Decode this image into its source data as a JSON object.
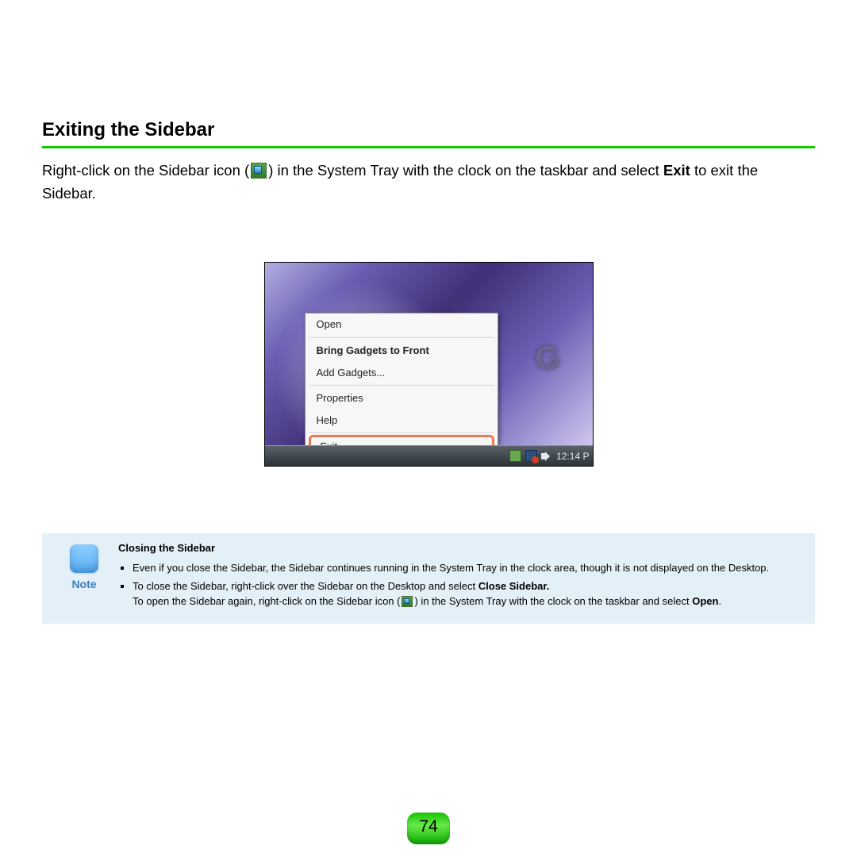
{
  "section": {
    "title": "Exiting the Sidebar",
    "intro_before_icon": "Right-click on the Sidebar icon (",
    "intro_after_icon": ") in the System Tray with the clock on the taskbar and select ",
    "intro_bold": "Exit",
    "intro_tail": " to exit the Sidebar."
  },
  "screenshot": {
    "menu": {
      "open": "Open",
      "bring_front": "Bring Gadgets to Front",
      "add_gadgets": "Add Gadgets...",
      "properties": "Properties",
      "help": "Help",
      "exit": "Exit"
    },
    "taskbar": {
      "clock": "12:14 P"
    }
  },
  "note": {
    "label": "Note",
    "subtitle": "Closing the Sidebar",
    "bullet1": "Even if you close the Sidebar, the Sidebar continues running in the System Tray in the clock area, though it is not displayed on the Desktop.",
    "bullet2_a": "To close the Sidebar, right-click over the Sidebar on the Desktop and select ",
    "bullet2_bold": "Close Sidebar.",
    "bullet2_line2_a": "To open the Sidebar again, right-click on the Sidebar icon (",
    "bullet2_line2_b": ") in the System Tray with the clock on the taskbar and select ",
    "bullet2_line2_bold": "Open",
    "bullet2_line2_tail": "."
  },
  "page_number": "74"
}
